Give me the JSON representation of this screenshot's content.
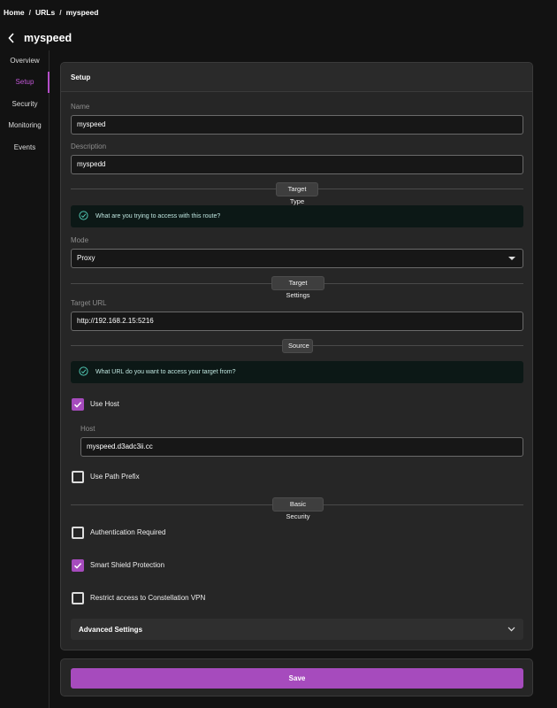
{
  "breadcrumb": {
    "home": "Home",
    "urls": "URLs",
    "current": "myspeed",
    "separator": "/"
  },
  "page": {
    "title": "myspeed"
  },
  "sidebar": {
    "items": [
      {
        "label": "Overview",
        "active": false
      },
      {
        "label": "Setup",
        "active": true
      },
      {
        "label": "Security",
        "active": false
      },
      {
        "label": "Monitoring",
        "active": false
      },
      {
        "label": "Events",
        "active": false
      }
    ]
  },
  "setup": {
    "header": "Setup",
    "name_label": "Name",
    "name_value": "myspeed",
    "description_label": "Description",
    "description_value": "myspedd",
    "target_type_divider": "Target Type",
    "target_type_hint": "What are you trying to access with this route?",
    "mode_label": "Mode",
    "mode_value": "Proxy",
    "target_settings_divider": "Target Settings",
    "target_url_label": "Target URL",
    "target_url_value": "http://192.168.2.15:5216",
    "source_divider": "Source",
    "source_hint": "What URL do you want to access your target from?",
    "use_host_label": "Use Host",
    "use_host_checked": true,
    "host_label": "Host",
    "host_value": "myspeed.d3adc3ii.cc",
    "use_path_prefix_label": "Use Path Prefix",
    "use_path_prefix_checked": false,
    "basic_security_divider": "Basic Security",
    "auth_required_label": "Authentication Required",
    "auth_required_checked": false,
    "smart_shield_label": "Smart Shield Protection",
    "smart_shield_checked": true,
    "restrict_vpn_label": "Restrict access to Constellation VPN",
    "restrict_vpn_checked": false,
    "advanced_settings_label": "Advanced Settings"
  },
  "actions": {
    "save_label": "Save"
  },
  "colors": {
    "accent": "#a64bbd",
    "hint_icon": "#4fc3b0",
    "background": "#121212",
    "card": "#262626"
  }
}
